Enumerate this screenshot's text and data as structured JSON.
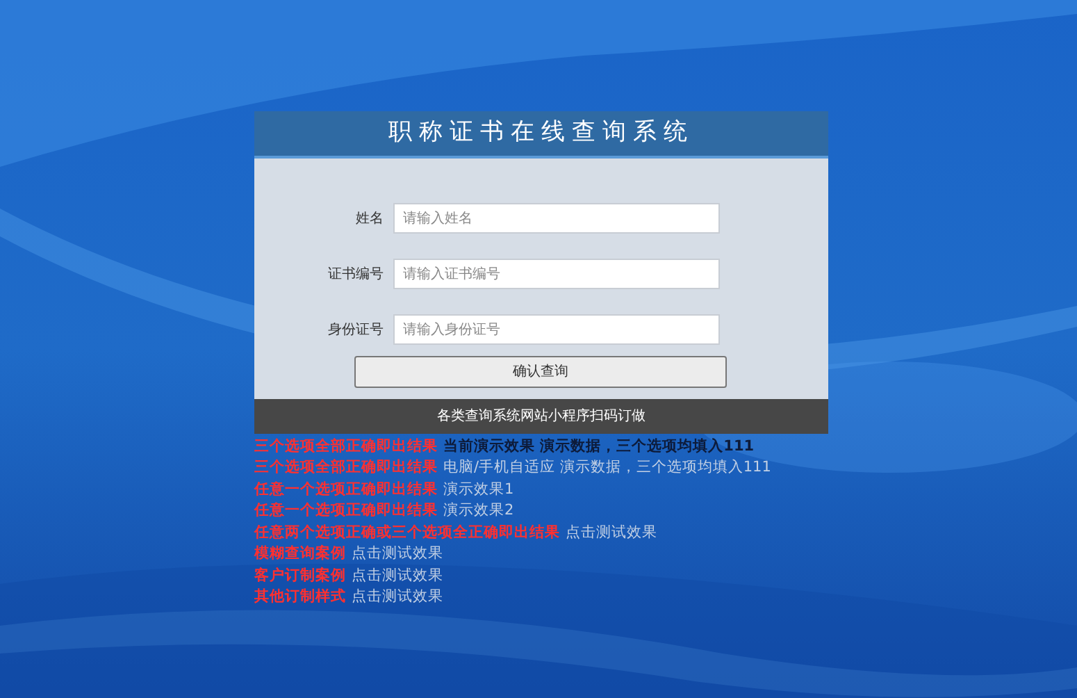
{
  "title": "职称证书在线查询系统",
  "fields": [
    {
      "label": "姓名",
      "placeholder": "请输入姓名"
    },
    {
      "label": "证书编号",
      "placeholder": "请输入证书编号"
    },
    {
      "label": "身份证号",
      "placeholder": "请输入身份证号"
    }
  ],
  "submit_button": "确认查询",
  "footer": "各类查询系统网站小程序扫码订做",
  "demo_links": [
    {
      "caption": "三个选项全部正确即出结果",
      "link": "当前演示效果 演示数据，三个选项均填入111",
      "current": true
    },
    {
      "caption": "三个选项全部正确即出结果",
      "link": "电脑/手机自适应 演示数据，三个选项均填入111",
      "current": false
    },
    {
      "caption": "任意一个选项正确即出结果",
      "link": "演示效果1",
      "current": false
    },
    {
      "caption": "任意一个选项正确即出结果",
      "link": "演示效果2",
      "current": false
    },
    {
      "caption": "任意两个选项正确或三个选项全正确即出结果",
      "link": "点击测试效果",
      "current": false
    },
    {
      "caption": "模糊查询案例",
      "link": "点击测试效果",
      "current": false
    },
    {
      "caption": "客户订制案例",
      "link": "点击测试效果",
      "current": false
    },
    {
      "caption": "其他订制样式",
      "link": "点击测试效果",
      "current": false
    }
  ]
}
